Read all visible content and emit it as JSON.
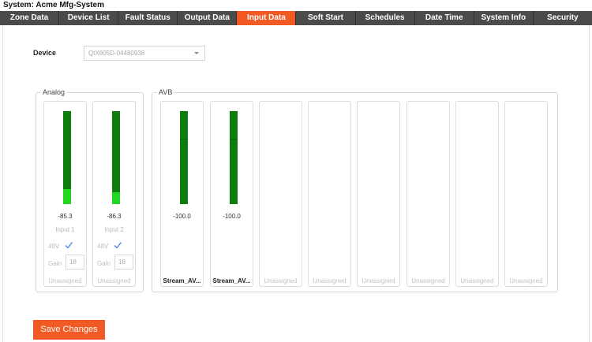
{
  "system_title": "System: Acme Mfg-System",
  "tabs": [
    {
      "label": "Zone Data",
      "active": false
    },
    {
      "label": "Device List",
      "active": false
    },
    {
      "label": "Fault Status",
      "active": false
    },
    {
      "label": "Output Data",
      "active": false
    },
    {
      "label": "Input Data",
      "active": true
    },
    {
      "label": "Soft Start",
      "active": false
    },
    {
      "label": "Schedules",
      "active": false
    },
    {
      "label": "Date Time",
      "active": false
    },
    {
      "label": "System Info",
      "active": false
    },
    {
      "label": "Security",
      "active": false
    }
  ],
  "device": {
    "label": "Device",
    "selected": "QtX805D-04480938"
  },
  "analog": {
    "title": "Analog",
    "channels": [
      {
        "level": "-85.3",
        "name": "Input 1",
        "phantom_label": "48V",
        "phantom_checked": true,
        "gain_label": "Gain",
        "gain": "18",
        "assignment": "Unassigned",
        "meter_fill": 0.16
      },
      {
        "level": "-86.3",
        "name": "Input 2",
        "phantom_label": "48V",
        "phantom_checked": true,
        "gain_label": "Gain",
        "gain": "18",
        "assignment": "Unassigned",
        "meter_fill": 0.13
      }
    ]
  },
  "avb": {
    "title": "AVB",
    "channels": [
      {
        "level": "-100.0",
        "assignment": "Stream_AV...",
        "has_meter": true
      },
      {
        "level": "-100.0",
        "assignment": "Stream_AV...",
        "has_meter": true
      },
      {
        "assignment": "Unassigned",
        "has_meter": false
      },
      {
        "assignment": "Unassigned",
        "has_meter": false
      },
      {
        "assignment": "Unassigned",
        "has_meter": false
      },
      {
        "assignment": "Unassigned",
        "has_meter": false
      },
      {
        "assignment": "Unassigned",
        "has_meter": false
      },
      {
        "assignment": "Unassigned",
        "has_meter": false
      }
    ]
  },
  "save_label": "Save Changes",
  "colors": {
    "accent": "#f15a24",
    "tab_bg": "#4b4b4b",
    "meter_dark": "#0d7d0d",
    "meter_bright": "#22d622"
  }
}
